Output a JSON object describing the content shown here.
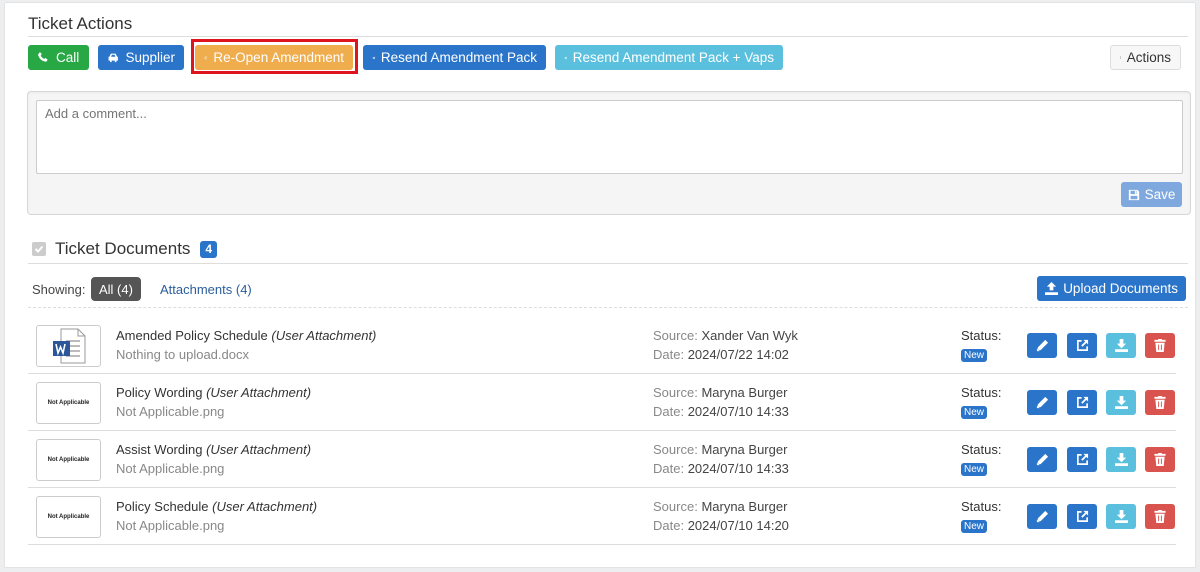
{
  "ticket_actions": {
    "title": "Ticket Actions",
    "buttons": {
      "call": "Call",
      "supplier": "Supplier",
      "reopen": "Re-Open Amendment",
      "resend": "Resend Amendment Pack",
      "resend_vaps": "Resend Amendment Pack + Vaps",
      "actions": "Actions"
    }
  },
  "comment": {
    "placeholder": "Add a comment...",
    "save_label": "Save"
  },
  "documents": {
    "title": "Ticket Documents",
    "count": "4",
    "showing_label": "Showing:",
    "filter_all": "All (4)",
    "filter_attachments": "Attachments (4)",
    "upload_label": "Upload Documents",
    "items": [
      {
        "name": "Amended Policy Schedule",
        "tag": "(User Attachment)",
        "file": "Nothing to upload.docx",
        "source_label": "Source:",
        "source": "Xander Van Wyk",
        "date_label": "Date:",
        "date": "2024/07/22 14:02",
        "status_label": "Status:",
        "status": "New",
        "thumb": "word-icon"
      },
      {
        "name": "Policy Wording",
        "tag": "(User Attachment)",
        "file": "Not Applicable.png",
        "source_label": "Source:",
        "source": "Maryna Burger",
        "date_label": "Date:",
        "date": "2024/07/10 14:33",
        "status_label": "Status:",
        "status": "New",
        "thumb_text": "Not Applicable"
      },
      {
        "name": "Assist Wording",
        "tag": "(User Attachment)",
        "file": "Not Applicable.png",
        "source_label": "Source:",
        "source": "Maryna Burger",
        "date_label": "Date:",
        "date": "2024/07/10 14:33",
        "status_label": "Status:",
        "status": "New",
        "thumb_text": "Not Applicable"
      },
      {
        "name": "Policy Schedule",
        "tag": "(User Attachment)",
        "file": "Not Applicable.png",
        "source_label": "Source:",
        "source": "Maryna Burger",
        "date_label": "Date:",
        "date": "2024/07/10 14:20",
        "status_label": "Status:",
        "status": "New",
        "thumb_text": "Not Applicable"
      }
    ]
  },
  "colors": {
    "primary": "#2a74c9",
    "success": "#28a745",
    "warning": "#f0ad4e",
    "info": "#5bc0de",
    "danger": "#d9534f",
    "highlight": "#e0141e"
  }
}
